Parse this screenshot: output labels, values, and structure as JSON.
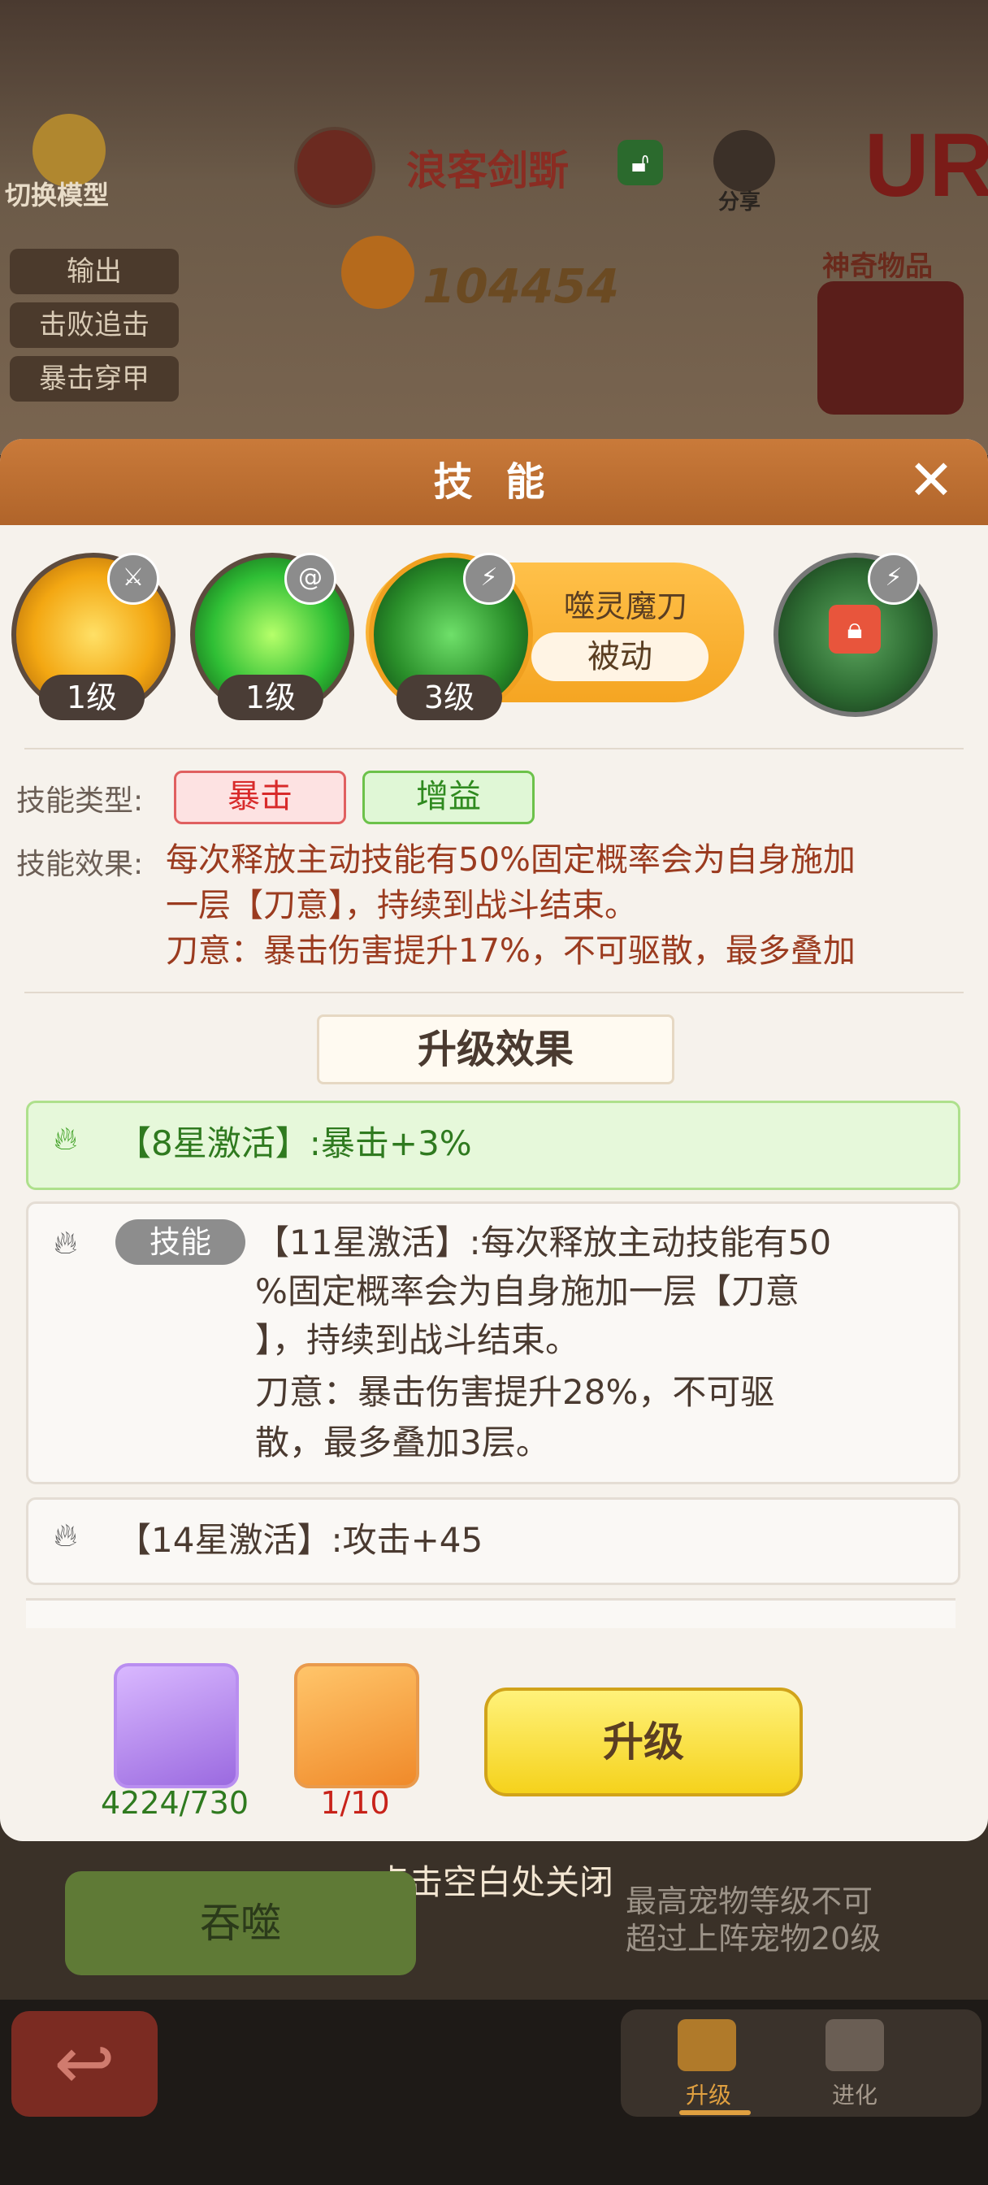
{
  "top_bar": {
    "switch_model_label": "切换模型",
    "character_name": "浪客剑斲",
    "share_label": "分享",
    "rarity": "UR",
    "power": "104454",
    "special_item_label": "神奇物品"
  },
  "side_tags": [
    "输出",
    "击败追击",
    "暴击穿甲"
  ],
  "modal": {
    "title": "技 能",
    "close_icon": "close-icon",
    "skills": [
      {
        "level": "1级",
        "color": "#f3a712",
        "badge_icon": "sword-icon"
      },
      {
        "level": "1级",
        "color": "#2fbf35",
        "badge_icon": "swirl-icon"
      },
      {
        "level": "3级",
        "color": "#2a8f2a",
        "badge_icon": "claw-icon",
        "selected": true
      },
      {
        "level": "",
        "color": "#3a7a40",
        "badge_icon": "claw-icon",
        "locked": true
      }
    ],
    "selected_skill": {
      "name": "噬灵魔刀",
      "type": "被动"
    },
    "skill_type_label": "技能类型:",
    "skill_tags": [
      "暴击",
      "增益"
    ],
    "skill_effect_label": "技能效果:",
    "skill_effect_lines": [
      "每次释放主动技能有50%固定概率会为自身施加",
      "一层【刀意】，持续到战斗结束。",
      "刀意：暴击伤害提升17%，不可驱散，最多叠加"
    ],
    "upgrade_effect_title": "升级效果",
    "effects": [
      {
        "text": "【8星激活】:暴击+3%",
        "active": true
      },
      {
        "tag": "技能",
        "lines": [
          "【11星激活】:每次释放主动技能有50",
          "%固定概率会为自身施加一层【刀意",
          "】，持续到战斗结束。",
          "刀意：暴击伤害提升28%，不可驱",
          "散，最多叠加3层。"
        ]
      },
      {
        "text": "【14星激活】:攻击+45"
      }
    ],
    "resources": [
      {
        "icon": "crystal-icon",
        "count": "4224/730",
        "count_color": "#2f7a1f"
      },
      {
        "icon": "scroll-icon",
        "count": "1/10",
        "count_color": "#c8231a"
      }
    ],
    "upgrade_button": "升级"
  },
  "close_hint": "点击空白处关闭",
  "devour_button": "吞噬",
  "limit_text_lines": [
    "最高宠物等级不可",
    "超过上阵宠物20级"
  ],
  "bottom_nav": {
    "back_icon": "back-arrow-icon",
    "tabs": [
      {
        "label": "升级",
        "active": true
      },
      {
        "label": "进化"
      }
    ]
  }
}
